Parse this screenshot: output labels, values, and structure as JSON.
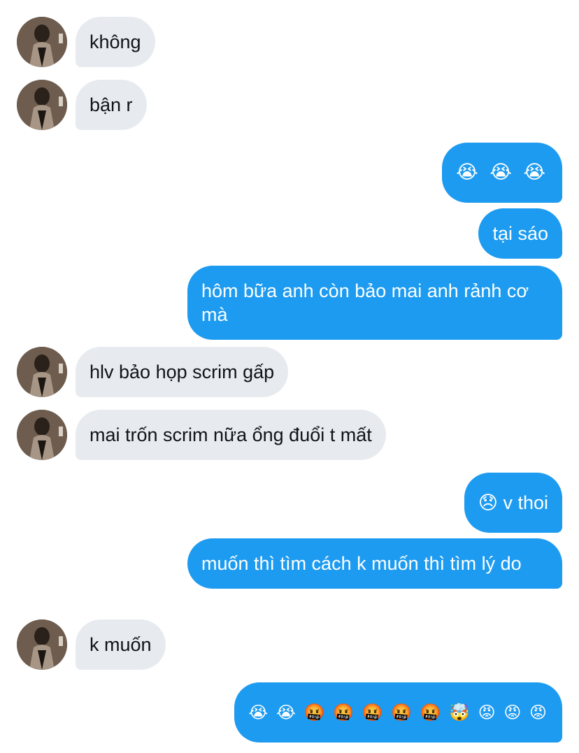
{
  "conversation": {
    "messages": [
      {
        "side": "received",
        "text": "không"
      },
      {
        "side": "received",
        "text": "bận r"
      },
      {
        "side": "sent",
        "text": "😭 😭 😭"
      },
      {
        "side": "sent",
        "text": "tại sáo"
      },
      {
        "side": "sent",
        "text": "hôm bữa anh còn bảo mai anh rảnh cơ mà"
      },
      {
        "side": "received",
        "text": "hlv bảo họp scrim gấp"
      },
      {
        "side": "received",
        "text": "mai trốn scrim nữa ổng đuổi t mất"
      },
      {
        "side": "sent",
        "text": "😞 v thoi"
      },
      {
        "side": "sent",
        "text": "muốn thì tìm cách k muốn thì tìm lý do"
      },
      {
        "side": "received",
        "text": "k muốn"
      },
      {
        "side": "sent",
        "text": "😭 😭 🤬 🤬 🤬 🤬 🤬 🤯 😡 😡 😡"
      }
    ]
  },
  "theme": {
    "sent_bubble_color": "#1d9bf0",
    "received_bubble_color": "#e7ebef",
    "sent_text_color": "#ffffff",
    "received_text_color": "#0f1419"
  },
  "avatar": {
    "icon": "user-avatar-photo"
  }
}
